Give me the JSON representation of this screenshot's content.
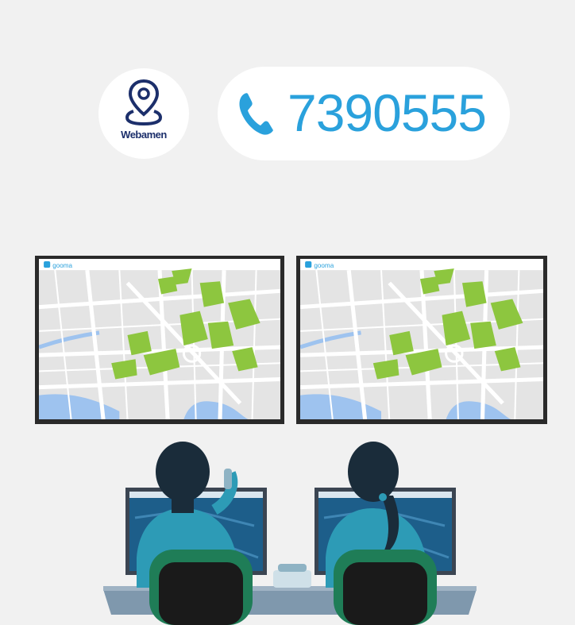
{
  "brand": {
    "name": "Webamen",
    "icon": "map-pin-icon"
  },
  "contact": {
    "phone_number": "7390555",
    "icon": "phone-handset-icon"
  },
  "monitors": [
    {
      "brand_label": "gooma"
    },
    {
      "brand_label": "gooma"
    }
  ],
  "colors": {
    "background": "#f1f1f1",
    "accent_blue": "#2aa1dc",
    "brand_navy": "#1c2f6b",
    "park_green": "#8dc63f",
    "uniform_teal": "#2d9bb6",
    "chair_green": "#1f7d57"
  }
}
